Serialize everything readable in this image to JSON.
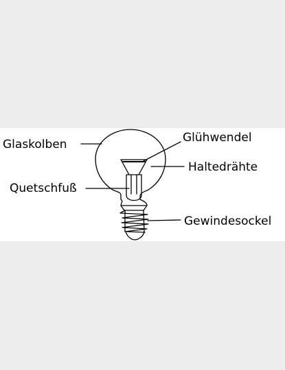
{
  "diagram": {
    "labels": {
      "glaskolben": "Glaskolben",
      "gluehwendel": "Glühwendel",
      "haltedraehte": "Haltedrähte",
      "quetschfuss": "Quetschfuß",
      "gewindesockel": "Gewindesockel"
    },
    "colors": {
      "page_background": "#ececec",
      "panel_background": "#ffffff",
      "line": "#000000"
    }
  }
}
